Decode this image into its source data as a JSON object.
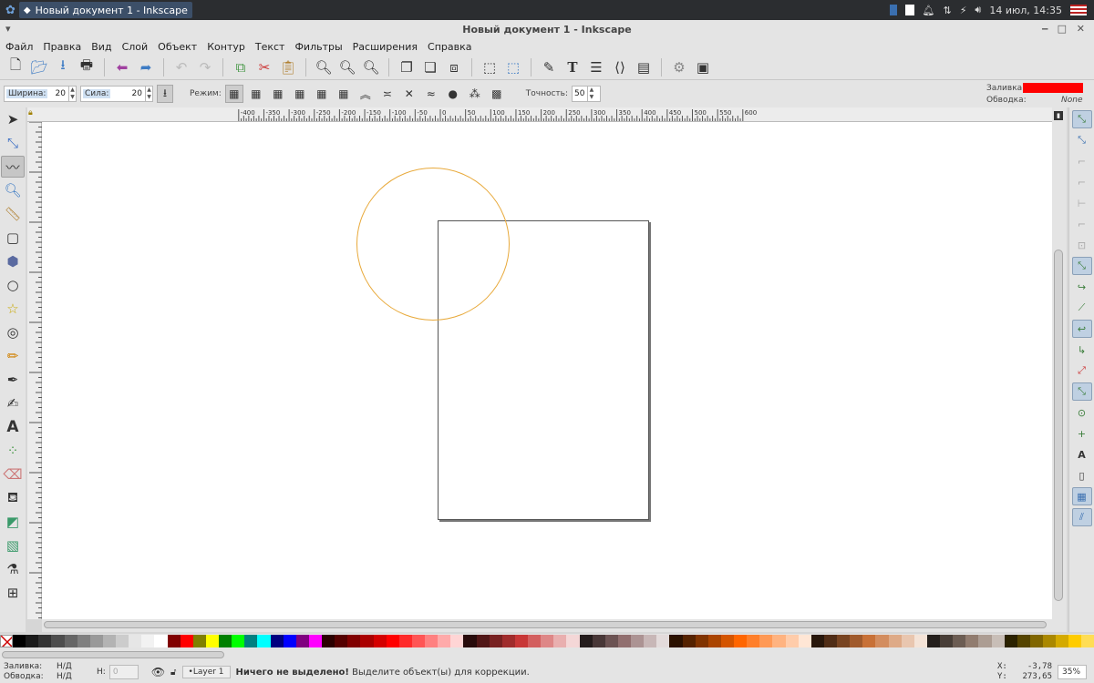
{
  "taskbar": {
    "window_title": "Новый документ 1 - Inkscape",
    "clock": "14 июл, 14:35"
  },
  "titlebar": {
    "title": "Новый документ 1 - Inkscape"
  },
  "menu": [
    "Файл",
    "Правка",
    "Вид",
    "Слой",
    "Объект",
    "Контур",
    "Текст",
    "Фильтры",
    "Расширения",
    "Справка"
  ],
  "tweak": {
    "width_label": "Ширина:",
    "width_value": "20",
    "force_label": "Сила:",
    "force_value": "20",
    "mode_label": "Режим:",
    "fidelity_label": "Точность:",
    "fidelity_value": "50"
  },
  "style_indicator": {
    "fill_label": "Заливка:",
    "stroke_label": "Обводка:",
    "stroke_value": "None",
    "fill_color": "#ff0000"
  },
  "ruler": {
    "labels": [
      "-400",
      "-350",
      "-300",
      "-250",
      "-200",
      "-150",
      "-100",
      "-50",
      "0",
      "50",
      "100",
      "150",
      "200",
      "250",
      "300",
      "350",
      "400",
      "450",
      "500",
      "550",
      "600"
    ]
  },
  "palette": [
    "#000000",
    "#1a1a1a",
    "#333333",
    "#4d4d4d",
    "#666666",
    "#808080",
    "#999999",
    "#b3b3b3",
    "#cccccc",
    "#e6e6e6",
    "#f2f2f2",
    "#ffffff",
    "#800000",
    "#ff0000",
    "#808000",
    "#ffff00",
    "#008000",
    "#00ff00",
    "#008080",
    "#00ffff",
    "#000080",
    "#0000ff",
    "#800080",
    "#ff00ff",
    "#2b0000",
    "#550000",
    "#800000",
    "#aa0000",
    "#d40000",
    "#ff0000",
    "#ff2a2a",
    "#ff5555",
    "#ff8080",
    "#ffaaaa",
    "#ffd5d5",
    "#280b0b",
    "#501616",
    "#782121",
    "#a02c2c",
    "#c83737",
    "#d35f5f",
    "#de8787",
    "#e9afaf",
    "#f4d7d7",
    "#241c1c",
    "#483737",
    "#6c5353",
    "#916f6f",
    "#ac9393",
    "#c8b7b7",
    "#e3dbdb",
    "#2b1100",
    "#552200",
    "#803300",
    "#aa4400",
    "#d45500",
    "#ff6600",
    "#ff7f2a",
    "#ff9955",
    "#ffb380",
    "#ffccaa",
    "#ffe6d5",
    "#28170b",
    "#502d16",
    "#784421",
    "#a05a2c",
    "#c87137",
    "#d38d5f",
    "#deaa87",
    "#e9c6af",
    "#f4e3d7",
    "#241f1c",
    "#483e37",
    "#6c5d53",
    "#917c6f",
    "#ac9d93",
    "#c8beb7",
    "#2b2200",
    "#554400",
    "#806600",
    "#aa8800",
    "#d4aa00",
    "#ffcc00",
    "#ffdd55"
  ],
  "status": {
    "fill_label": "Заливка:",
    "fill_value": "Н/Д",
    "stroke_label": "Обводка:",
    "stroke_value": "Н/Д",
    "h_label": "Н:",
    "h_value": "0",
    "layer": "•Layer 1",
    "message_bold": "Ничего не выделено!",
    "message": " Выделите объект(ы) для коррекции.",
    "x_label": "X:",
    "x_value": "-3,78",
    "y_label": "Y:",
    "y_value": "273,65",
    "zoom": "35%"
  }
}
